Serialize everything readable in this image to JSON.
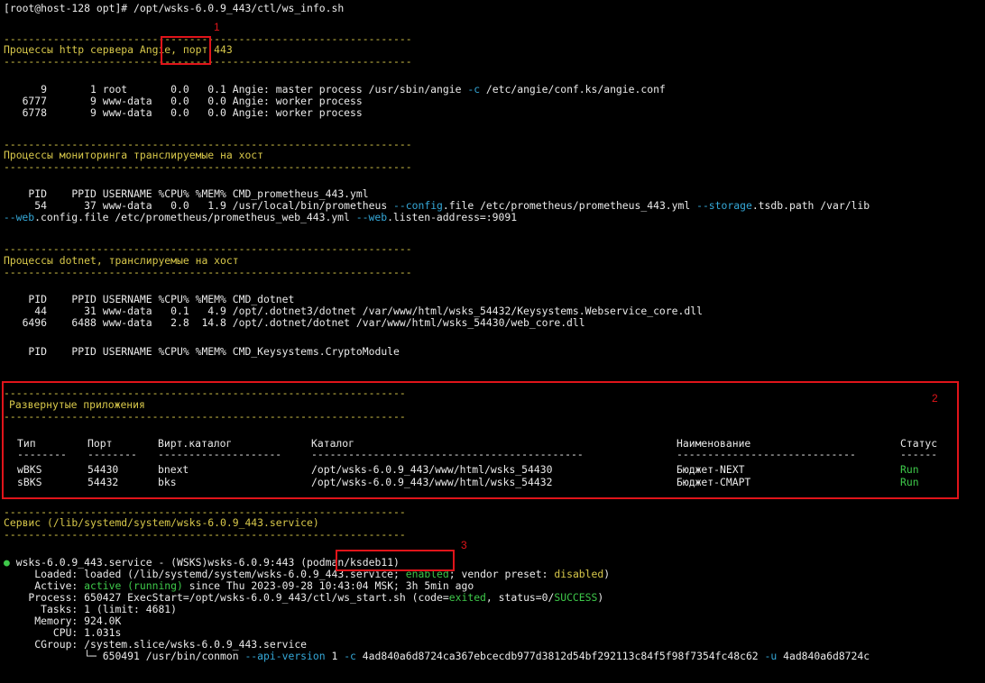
{
  "prompt": "[root@host-128 opt]# /opt/wsks-6.0.9_443/ctl/ws_info.sh",
  "separator": "------------------------------------------------------------------",
  "short_separator": "-----------------------------------------------------------------",
  "http_section": {
    "title_prefix": "Процессы http сервера ",
    "title_highlight": "Angie,",
    "title_suffix": " порт 443",
    "rows": [
      "      9       1 root       0.0   0.1 Angie: master process /usr/sbin/angie ",
      "   6777       9 www-data   0.0   0.0 Angie: worker process",
      "   6778       9 www-data   0.0   0.0 Angie: worker process"
    ],
    "row0_flag": "-c",
    "row0_tail": " /etc/angie/conf.ks/angie.conf"
  },
  "monitoring_section": {
    "title": "Процессы мониторинга транслируемые на хост",
    "header": "    PID    PPID USERNAME %CPU% %MEM% CMD_prometheus_443.yml",
    "row1_a": "     54      37 www-data   0.0   1.9 /usr/local/bin/prometheus ",
    "row1_flag1": "--config",
    "row1_b": ".file /etc/prometheus/prometheus_443.yml ",
    "row1_flag2": "--storage",
    "row1_c": ".tsdb.path /var/lib",
    "row2_flag1": " --web",
    "row2_b": ".config.file /etc/prometheus/prometheus_web_443.yml ",
    "row2_flag2": "--web",
    "row2_c": ".listen-address=:9091"
  },
  "dotnet_section": {
    "title": "Процессы dotnet, транслируемые на хост",
    "header": "    PID    PPID USERNAME %CPU% %MEM% CMD_dotnet",
    "rows": [
      "     44      31 www-data   0.1   4.9 /opt/.dotnet3/dotnet /var/www/html/wsks_54432/Keysystems.Webservice_core.dll",
      "   6496    6488 www-data   2.8  14.8 /opt/.dotnet/dotnet /var/www/html/wsks_54430/web_core.dll"
    ],
    "crypto_header": "    PID    PPID USERNAME %CPU% %MEM% CMD_Keysystems.CryptoModule"
  },
  "apps_section": {
    "title": "Развернутые приложения",
    "columns": [
      "Тип",
      "Порт",
      "Вирт.каталог",
      "Каталог",
      "Наименование",
      "Статус"
    ],
    "dashes": [
      "--------",
      "--------",
      "--------------------",
      "--------------------------------------------",
      "-----------------------------",
      "------"
    ],
    "rows": [
      {
        "type": "wBKS",
        "port": "54430",
        "vdir": "bnext",
        "dir": "/opt/wsks-6.0.9_443/www/html/wsks_54430",
        "name": "Бюджет-NEXT",
        "status": "Run"
      },
      {
        "type": "sBKS",
        "port": "54432",
        "vdir": "bks",
        "dir": "/opt/wsks-6.0.9_443/www/html/wsks_54432",
        "name": "Бюджет-СМАРТ",
        "status": "Run"
      }
    ]
  },
  "service_section": {
    "title": "Сервис (/lib/systemd/system/wsks-6.0.9_443.service)",
    "bullet": "●",
    "unit_line": " wsks-6.0.9_443.service - (WSKS)wsks-6.0.9:443 ",
    "unit_highlight": "(podman/ksdeb11)",
    "loaded_a": "     Loaded: loaded (/lib/systemd/system/wsks-6.0.9_443.service; ",
    "loaded_enabled": "enabled",
    "loaded_b": "; vendor preset: ",
    "loaded_disabled": "disabled",
    "loaded_c": ")",
    "active_a": "     Active: ",
    "active_state": "active (running)",
    "active_b": " since Thu 2023-09-28 10:43:04 MSK; 3h 5min ago",
    "process_a": "    Process: 650427 ExecStart=/opt/wsks-6.0.9_443/ctl/ws_start.sh (code=",
    "process_exited": "exited",
    "process_b": ", status=0/",
    "process_success": "SUCCESS",
    "process_c": ")",
    "tasks": "      Tasks: 1 (limit: 4681)",
    "memory": "     Memory: 924.0K",
    "cpu": "        CPU: 1.031s",
    "cgroup": "     CGroup: /system.slice/wsks-6.0.9_443.service",
    "conmon_a": "             └─ 650491 /usr/bin/conmon ",
    "conmon_flag": "--api-version",
    "conmon_b": " 1 ",
    "conmon_flag2": "-c",
    "conmon_c": " 4ad840a6d8724ca367ebcecdb977d3812d54bf292113c84f5f98f7354fc48c62 ",
    "conmon_flag3": "-u",
    "conmon_d": " 4ad840a6d8724c"
  },
  "annotations": {
    "m1": "1",
    "m2": "2",
    "m3": "3"
  },
  "colors": {
    "background": "#000000",
    "text": "#e8e8e8",
    "yellow": "#d8c84a",
    "green": "#3ec94a",
    "cyan": "#35a8d8",
    "annotation_red": "#e0141a"
  }
}
